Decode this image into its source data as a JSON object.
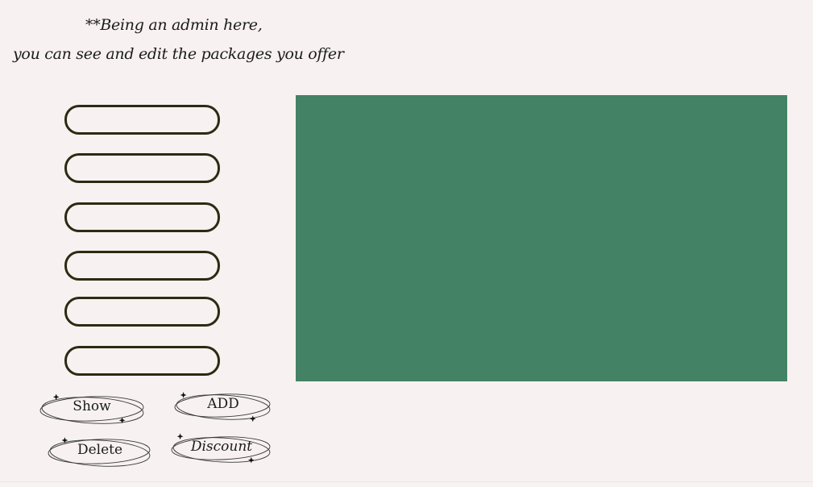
{
  "intro": {
    "line1": "**Being an admin here,",
    "line2": "you can see and edit the packages you offer"
  },
  "fields": [
    {
      "value": "",
      "placeholder": ""
    },
    {
      "value": "",
      "placeholder": ""
    },
    {
      "value": "",
      "placeholder": ""
    },
    {
      "value": "",
      "placeholder": ""
    },
    {
      "value": "",
      "placeholder": ""
    },
    {
      "value": "",
      "placeholder": ""
    }
  ],
  "buttons": {
    "show": "Show",
    "add": "ADD",
    "delete": "Delete",
    "discount": "Discount"
  },
  "colors": {
    "background": "#f7f1f1",
    "panel": "#448266",
    "field_border": "#2e2a12"
  }
}
